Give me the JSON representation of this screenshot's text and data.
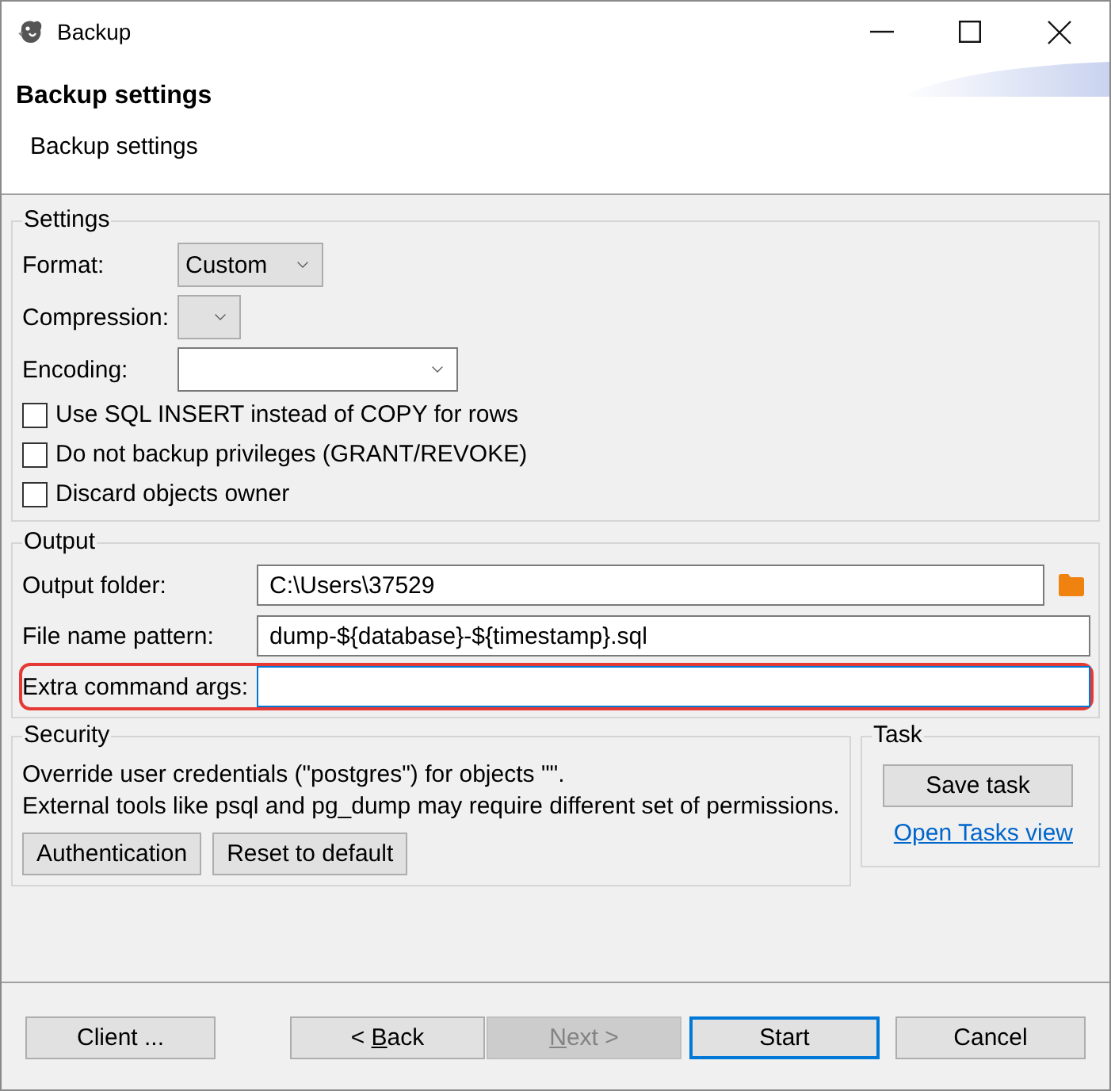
{
  "window": {
    "title": "Backup"
  },
  "header": {
    "title": "Backup settings",
    "description": "Backup settings"
  },
  "settings": {
    "legend": "Settings",
    "fields": [
      {
        "label": "Format:",
        "kind": "select",
        "value": "Custom"
      },
      {
        "label": "Compression:",
        "kind": "select"
      },
      {
        "label": "Encoding:",
        "kind": "combo"
      }
    ],
    "checkboxes": [
      {
        "label": "Use SQL INSERT instead of COPY for rows",
        "checked": false
      },
      {
        "label": "Do not backup privileges (GRANT/REVOKE)",
        "checked": false
      },
      {
        "label": "Discard objects owner",
        "checked": false
      }
    ]
  },
  "output": {
    "legend": "Output",
    "fields": [
      {
        "label": "Output folder:",
        "kind": "folder",
        "value": "C:\\Users\\37529",
        "focused": false,
        "highlighted": false
      },
      {
        "label": "File name pattern:",
        "kind": "text",
        "value": "dump-${database}-${timestamp}.sql",
        "focused": false,
        "highlighted": false
      },
      {
        "label": "Extra command args:",
        "kind": "text",
        "focused": true,
        "highlighted": true
      }
    ]
  },
  "security": {
    "legend": "Security",
    "lines": [
      "Override user credentials (\"postgres\") for objects \"\".",
      "External tools like psql and pg_dump may require different set of permissions."
    ],
    "buttons": [
      {
        "label": "Authentication"
      },
      {
        "label": "Reset to default"
      }
    ]
  },
  "task": {
    "legend": "Task",
    "button": {
      "label": "Save task"
    },
    "link": "Open Tasks view"
  },
  "footer": {
    "left": [
      {
        "label": "Client ...",
        "disabled": false,
        "default": false
      }
    ],
    "wizard": [
      {
        "label_parts": [
          {
            "text": "< ",
            "underlined": false
          },
          {
            "text": "B",
            "underlined": true
          },
          {
            "text": "ack",
            "underlined": false
          }
        ],
        "disabled": false,
        "default": false
      },
      {
        "label_parts": [
          {
            "text": "N",
            "underlined": true
          },
          {
            "text": "ext >",
            "underlined": false
          }
        ],
        "disabled": true,
        "default": false
      }
    ],
    "right": [
      {
        "label": "Start",
        "disabled": false,
        "default": true
      },
      {
        "label": "Cancel",
        "disabled": false,
        "default": false
      }
    ]
  }
}
